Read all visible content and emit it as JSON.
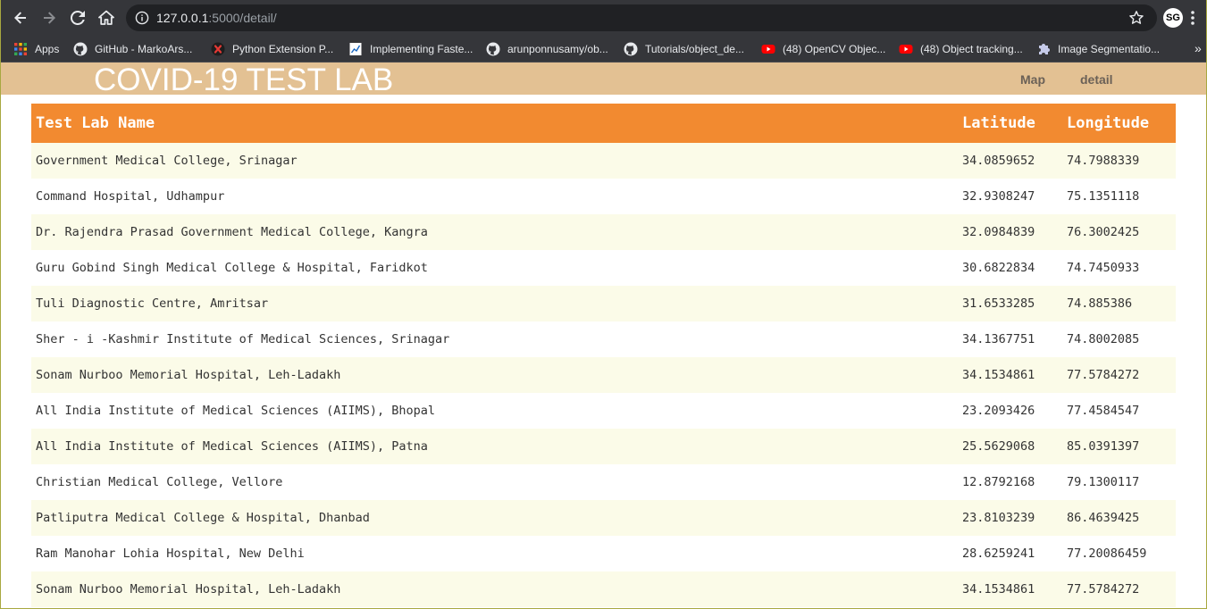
{
  "browser": {
    "url_host": "127.0.0.1",
    "url_path": ":5000/detail/",
    "profile_initials": "SG",
    "bookmarks": [
      {
        "label": "Apps",
        "icon": "apps-grid-icon"
      },
      {
        "label": "GitHub - MarkoArs...",
        "icon": "github-icon"
      },
      {
        "label": "Python Extension P...",
        "icon": "python-extension-icon"
      },
      {
        "label": "Implementing Faste...",
        "icon": "document-chart-icon"
      },
      {
        "label": "arunponnusamy/ob...",
        "icon": "github-icon"
      },
      {
        "label": "Tutorials/object_de...",
        "icon": "github-icon"
      },
      {
        "label": "(48) OpenCV Objec...",
        "icon": "youtube-icon"
      },
      {
        "label": "(48) Object tracking...",
        "icon": "youtube-icon"
      },
      {
        "label": "Image Segmentatio...",
        "icon": "puzzle-icon"
      }
    ],
    "colors": {
      "chrome": "#35363a",
      "omnibox": "#202124",
      "youtube": "#ff0000"
    }
  },
  "site": {
    "title": "COVID-19 TEST LAB",
    "nav": [
      {
        "label": "Map"
      },
      {
        "label": "detail"
      }
    ],
    "colors": {
      "header_bg": "#e3c193",
      "table_header_bg": "#f28a30",
      "row_stripe": "#fbfbe8"
    }
  },
  "table": {
    "columns": [
      "Test Lab Name",
      "Latitude",
      "Longitude"
    ],
    "rows": [
      [
        "Government Medical College, Srinagar",
        "34.0859652",
        "74.7988339"
      ],
      [
        "Command Hospital, Udhampur",
        "32.9308247",
        "75.1351118"
      ],
      [
        "Dr. Rajendra Prasad Government Medical College, Kangra",
        "32.0984839",
        "76.3002425"
      ],
      [
        "Guru Gobind Singh Medical College & Hospital, Faridkot",
        "30.6822834",
        "74.7450933"
      ],
      [
        "Tuli Diagnostic Centre, Amritsar",
        "31.6533285",
        "74.885386"
      ],
      [
        "Sher - i -Kashmir Institute of Medical Sciences, Srinagar",
        "34.1367751",
        "74.8002085"
      ],
      [
        "Sonam Nurboo Memorial Hospital, Leh-Ladakh",
        "34.1534861",
        "77.5784272"
      ],
      [
        "All India Institute of Medical Sciences (AIIMS), Bhopal",
        "23.2093426",
        "77.4584547"
      ],
      [
        "All India Institute of Medical Sciences (AIIMS), Patna",
        "25.5629068",
        "85.0391397"
      ],
      [
        "Christian Medical College, Vellore",
        "12.8792168",
        "79.1300117"
      ],
      [
        "Patliputra Medical College & Hospital, Dhanbad",
        "23.8103239",
        "86.4639425"
      ],
      [
        "Ram Manohar Lohia Hospital, New Delhi",
        "28.6259241",
        "77.20086459"
      ],
      [
        "Sonam Nurboo Memorial Hospital, Leh-Ladakh",
        "34.1534861",
        "77.5784272"
      ]
    ]
  }
}
